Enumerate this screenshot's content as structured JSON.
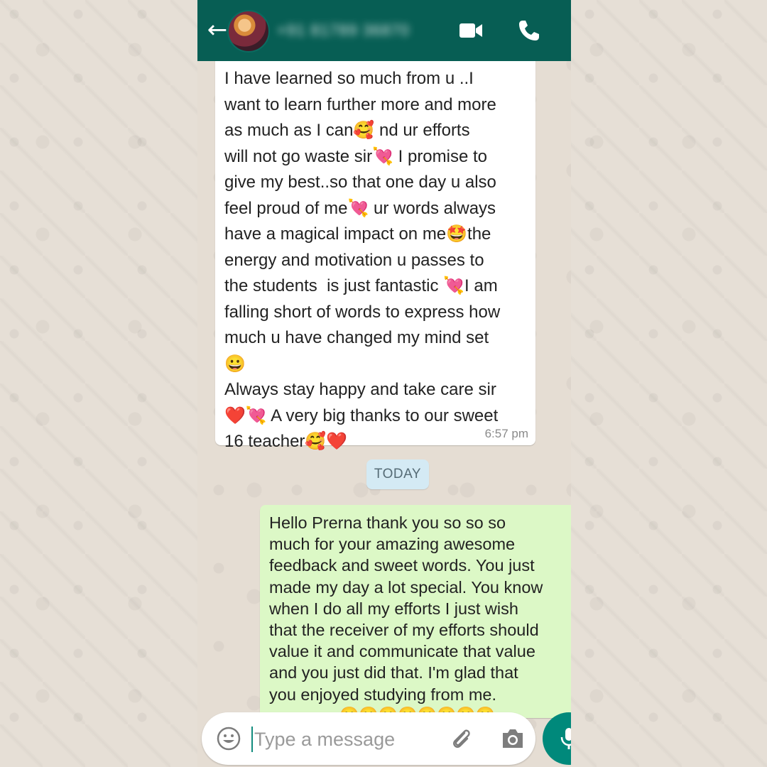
{
  "header": {
    "back_icon": "arrow-left-icon",
    "contact_name": "+91 81789 36870",
    "video_icon": "video-camera-icon",
    "call_icon": "phone-icon",
    "color": "#075e54"
  },
  "messages": {
    "incoming": {
      "text": "I have learned so much from u ..I\nwant to learn further more and more\nas much as I can🥰 nd ur efforts\nwill not go waste sir💘 I promise to\ngive my best..so that one day u also\nfeel proud of me💘 ur words always\nhave a magical impact on me🤩the\nenergy and motivation u passes to\nthe students  is just fantastic 💘I am\nfalling short of words to express how\nmuch u have changed my mind set\n😀\nAlways stay happy and take care sir\n❤️💘 A very big thanks to our sweet\n16 teacher🥰❤️",
      "time": "6:57 pm"
    },
    "date_separator": "TODAY",
    "outgoing": {
      "text": "Hello Prerna thank you so so so\nmuch for your amazing awesome\nfeedback and sweet words. You just\nmade my day a lot special. You know\nwhen I do all my efforts I just wish\nthat the receiver of my efforts should\nvalue it and communicate that value\nand you just did that. I'm glad that\nyou enjoyed studying from me.",
      "emoji_row": "😊😊😊😊😊😊😊😊"
    }
  },
  "composer": {
    "placeholder": "Type a message",
    "emoji_icon": "smiley-icon",
    "attach_icon": "paperclip-icon",
    "camera_icon": "camera-icon",
    "mic_icon": "microphone-icon"
  }
}
